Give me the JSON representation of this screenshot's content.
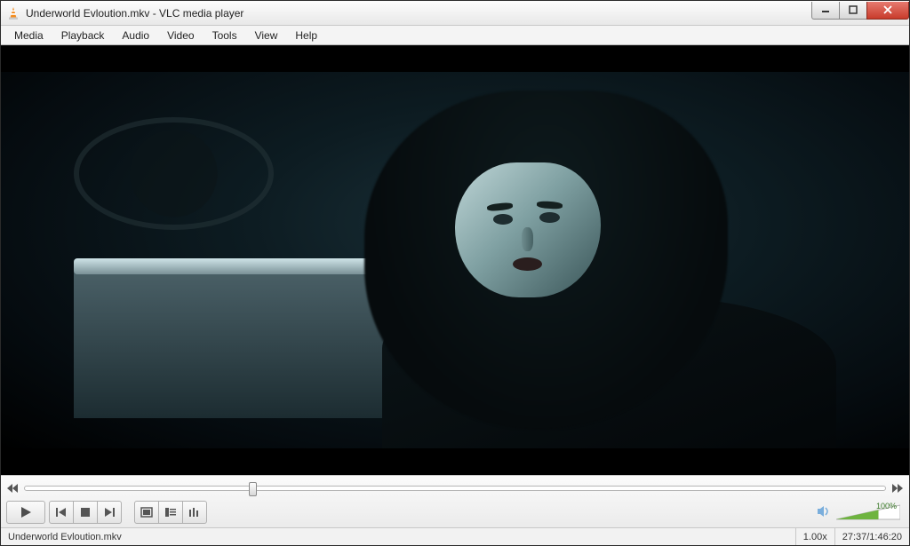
{
  "window": {
    "title": "Underworld Evloution.mkv - VLC media player"
  },
  "menu": {
    "items": [
      "Media",
      "Playback",
      "Audio",
      "Video",
      "Tools",
      "View",
      "Help"
    ]
  },
  "playback": {
    "seek_fraction": 0.26,
    "speed": "1.00x",
    "elapsed": "27:37",
    "total": "1:46:20",
    "elapsed_total": "27:37/1:46:20"
  },
  "volume": {
    "percent_label": "100%",
    "level_fraction": 0.66
  },
  "status": {
    "filename": "Underworld Evloution.mkv"
  }
}
